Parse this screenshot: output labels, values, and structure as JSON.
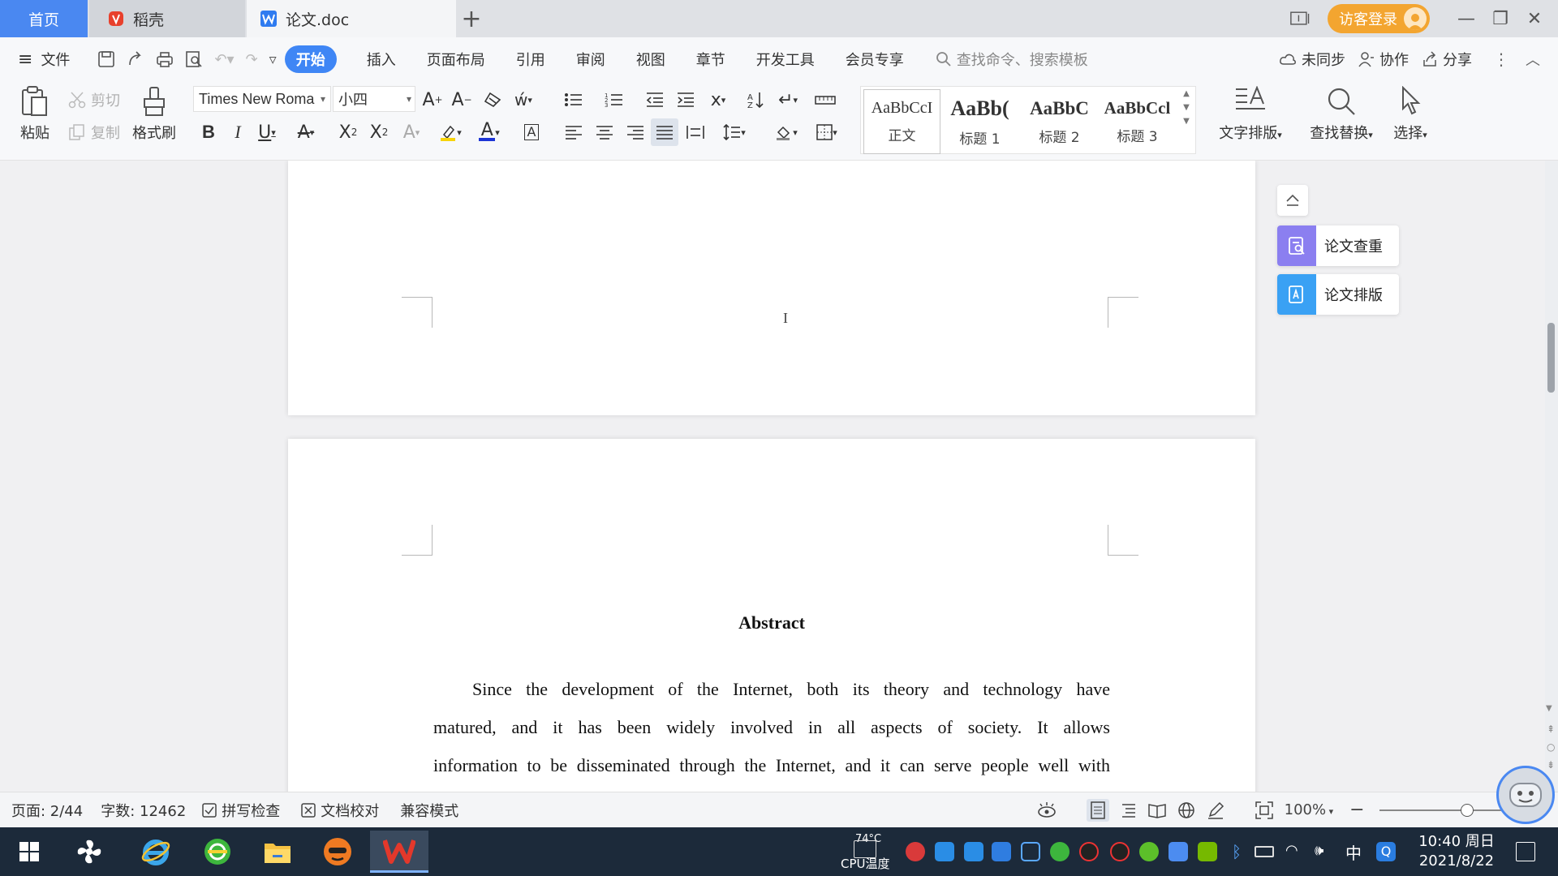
{
  "tabs": {
    "home": "首页",
    "daoke": "稻壳",
    "doc": "论文.doc",
    "login": "访客登录"
  },
  "menu": {
    "file": "文件",
    "start": "开始",
    "insert": "插入",
    "layout": "页面布局",
    "reference": "引用",
    "review": "审阅",
    "view": "视图",
    "chapter": "章节",
    "devtools": "开发工具",
    "member": "会员专享",
    "search_placeholder": "查找命令、搜索模板",
    "unsynced": "未同步",
    "collab": "协作",
    "share": "分享"
  },
  "ribbon": {
    "paste": "粘贴",
    "cut": "剪切",
    "copy": "复制",
    "format_painter": "格式刷",
    "font_name": "Times New Roma",
    "font_size": "小四",
    "styles": [
      {
        "sample": "AaBbCcI",
        "label": "正文"
      },
      {
        "sample": "AaBb(",
        "label": "标题 1"
      },
      {
        "sample": "AaBbC",
        "label": "标题 2"
      },
      {
        "sample": "AaBbCcl",
        "label": "标题 3"
      }
    ],
    "text_layout": "文字排版",
    "find_replace": "查找替换",
    "select": "选择"
  },
  "side_panel": {
    "check": "论文查重",
    "format": "论文排版"
  },
  "document": {
    "abstract_title": "Abstract",
    "paragraph_lines": [
      "Since the development of the Internet, both its theory and technology have",
      "matured, and it has been widely involved in all aspects of society. It allows",
      "information to be disseminated through the Internet, and it can serve people well with"
    ]
  },
  "status": {
    "page": "页面: 2/44",
    "words": "字数: 12462",
    "spell_check": "拼写检查",
    "proofread": "文档校对",
    "compat": "兼容模式",
    "zoom": "100%"
  },
  "taskbar": {
    "cpu_temp": "74°C",
    "cpu_label": "CPU温度",
    "ime": "中",
    "time": "10:40 周日",
    "date": "2021/8/22"
  },
  "colors": {
    "accent": "#3f86f5",
    "login": "#f3a530",
    "wps_red": "#d9382b",
    "taskbar": "#1c2a3a"
  }
}
